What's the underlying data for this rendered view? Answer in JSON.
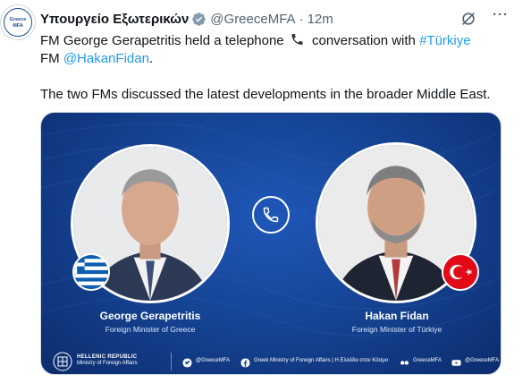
{
  "author": {
    "display_name": "Υπουργείο Εξωτερικών",
    "handle": "@GreeceMFA",
    "separator": "·",
    "time": "12m",
    "avatar_text_line1": "Greece",
    "avatar_text_line2": "MFA",
    "verified_icon": "verified-badge-icon",
    "menu_label": "···"
  },
  "tweet": {
    "line1_before": "FM George Gerapetritis held a telephone ",
    "line1_after": " conversation with ",
    "hashtag": "#Türkiye",
    "line2_prefix": "FM ",
    "mention": "@HakanFidan",
    "line2_suffix": ".",
    "line3": "The two FMs discussed the latest developments in the broader Middle East."
  },
  "card": {
    "left_person": {
      "name": "George Gerapetritis",
      "title": "Foreign Minister of Greece"
    },
    "right_person": {
      "name": "Hakan Fidan",
      "title": "Foreign Minister of Türkiye"
    },
    "ministry_line1": "HELLENIC REPUBLIC",
    "ministry_line2": "Ministry of Foreign Affairs",
    "social": [
      {
        "icon": "twitter-icon",
        "text": "@GreeceMFA"
      },
      {
        "icon": "facebook-icon",
        "text": "Greek Ministry of Foreign Affairs | Η Ελλάδα στον Κόσμο"
      },
      {
        "icon": "flickr-icon",
        "text": "GreeceMFA"
      },
      {
        "icon": "youtube-icon",
        "text": "@GreeceMFA"
      }
    ]
  },
  "colors": {
    "link": "#1d9bf0",
    "verified": "#829aab",
    "card_blue": "#164596"
  }
}
